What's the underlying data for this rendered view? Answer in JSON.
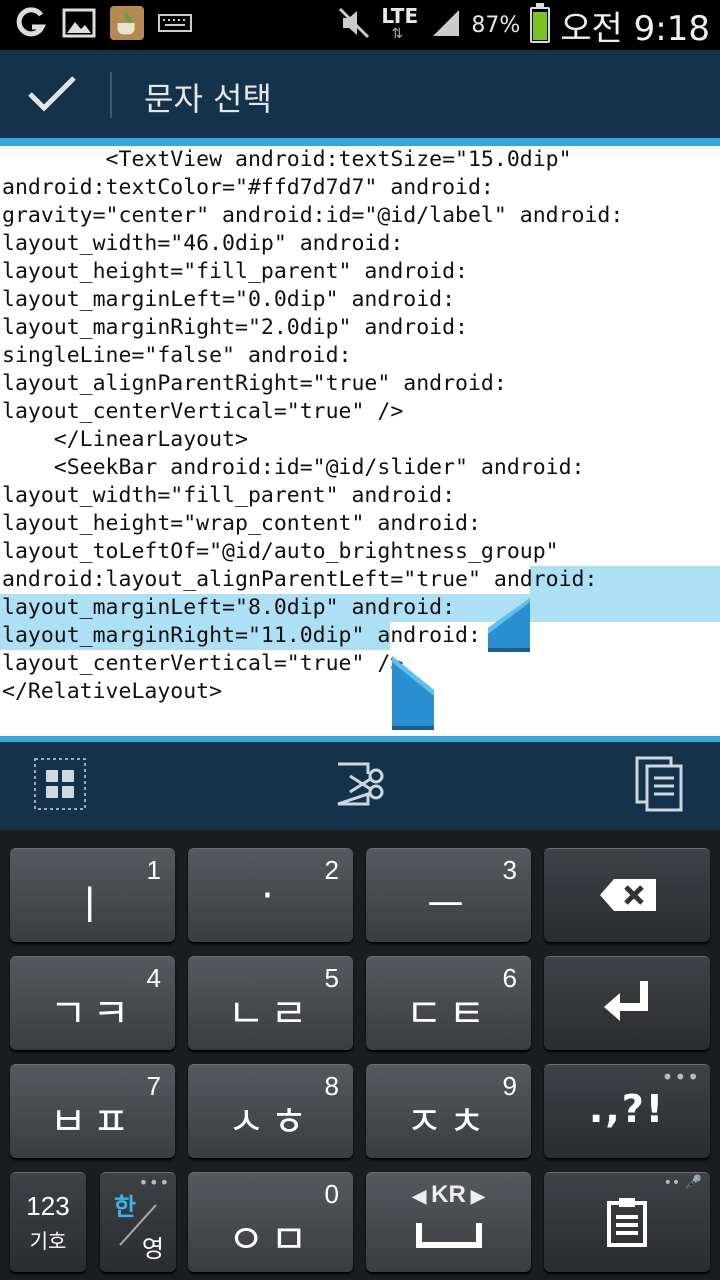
{
  "status_bar": {
    "network": "LTE",
    "battery_percent": "87%",
    "battery_level": 0.87,
    "clock": "오전 9:18"
  },
  "action_bar": {
    "title": "문자 선택"
  },
  "editor": {
    "lines": [
      "        <TextView android:textSize=\"15.0dip\"",
      "android:textColor=\"#ffd7d7d7\" android:",
      "gravity=\"center\" android:id=\"@id/label\" android:",
      "layout_width=\"46.0dip\" android:",
      "layout_height=\"fill_parent\" android:",
      "layout_marginLeft=\"0.0dip\" android:",
      "layout_marginRight=\"2.0dip\" android:",
      "singleLine=\"false\" android:",
      "layout_alignParentRight=\"true\" android:",
      "layout_centerVertical=\"true\" />",
      "    </LinearLayout>",
      "    <SeekBar android:id=\"@id/slider\" android:",
      "layout_width=\"fill_parent\" android:",
      "layout_height=\"wrap_content\" android:",
      "layout_toLeftOf=\"@id/auto_brightness_group\"",
      "android:layout_alignParentLeft=\"true\" android:",
      "layout_marginLeft=\"8.0dip\" android:",
      "layout_marginRight=\"11.0dip\" android:",
      "layout_centerVertical=\"true\" />",
      "</RelativeLayout>"
    ]
  },
  "keyboard": {
    "keys": [
      {
        "num": "1",
        "main": "ㅣ"
      },
      {
        "num": "2",
        "main": "·"
      },
      {
        "num": "3",
        "main": "ㅡ"
      },
      {
        "num": "4",
        "main": "ㄱㅋ"
      },
      {
        "num": "5",
        "main": "ㄴㄹ"
      },
      {
        "num": "6",
        "main": "ㄷㅌ"
      },
      {
        "num": "7",
        "main": "ㅂㅍ"
      },
      {
        "num": "8",
        "main": "ㅅㅎ"
      },
      {
        "num": "9",
        "main": "ㅈㅊ"
      },
      {
        "num": "0",
        "main": "ㅇㅁ"
      }
    ],
    "punct_label": ".,?!",
    "symbols_label_top": "123",
    "symbols_label_bottom": "기호",
    "lang_top": "한",
    "lang_bottom": "영",
    "lang_indicator": "KR",
    "more_dots": "•••"
  }
}
